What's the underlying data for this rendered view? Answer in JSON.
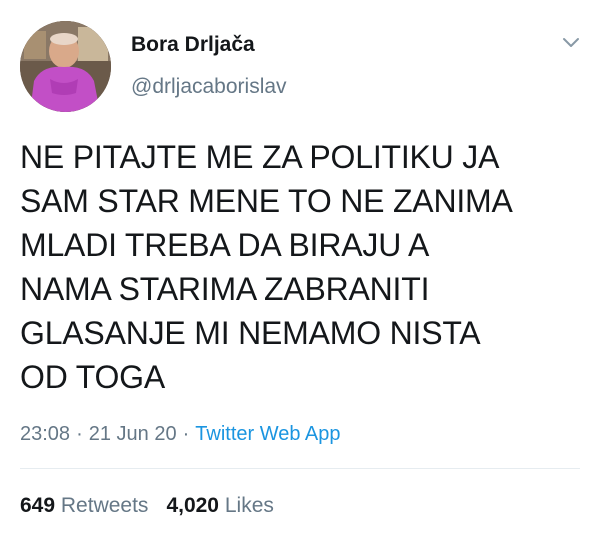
{
  "tweet": {
    "author": {
      "display_name": "Bora Drljača",
      "handle": "@drljacaborislav",
      "avatar_icon": "profile-photo"
    },
    "menu_icon": "chevron-down-icon",
    "text_lines": [
      "NE PITAJTE ME ZA POLITIKU JA",
      "SAM STAR MENE TO NE ZANIMA",
      "MLADI TREBA DA BIRAJU A",
      "NAMA STARIMA ZABRANITI",
      "GLASANJE MI NEMAMO NISTA",
      "OD TOGA"
    ],
    "time": "23:08",
    "separator": "·",
    "date": "21 Jun 20",
    "source": "Twitter Web App",
    "retweets_count": "649",
    "retweets_label": "Retweets",
    "likes_count": "4,020",
    "likes_label": "Likes"
  },
  "colors": {
    "text_primary": "#14171a",
    "text_secondary": "#657786",
    "link": "#1b95e0",
    "divider": "#e6ecf0"
  }
}
